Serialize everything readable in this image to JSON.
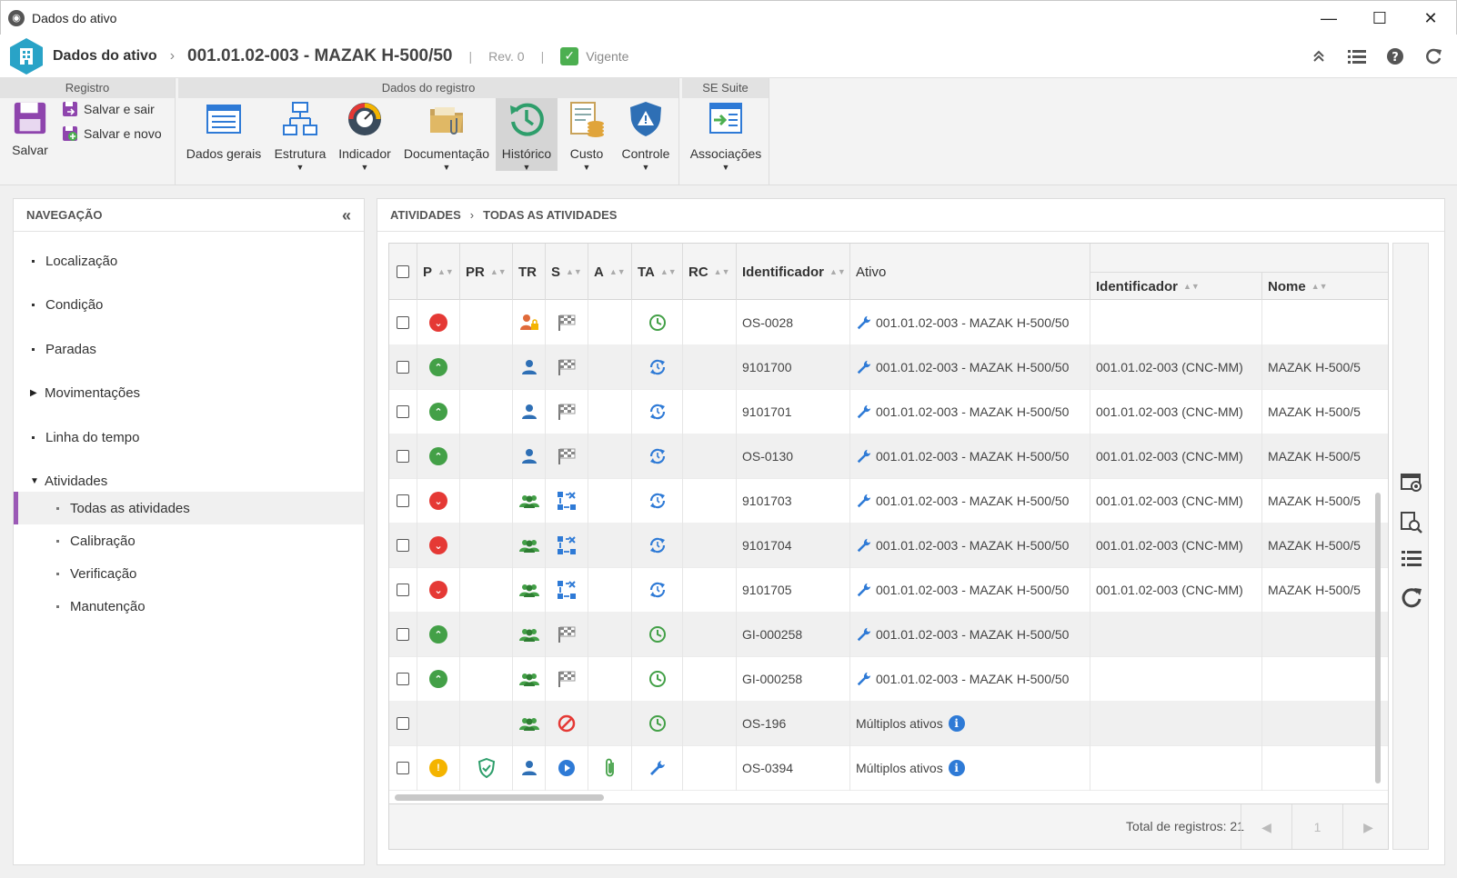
{
  "window": {
    "title": "Dados do ativo"
  },
  "header": {
    "section": "Dados do ativo",
    "asset": "001.01.02-003 - MAZAK H-500/50",
    "revision": "Rev. 0",
    "status": "Vigente",
    "status_color": "#4caf50"
  },
  "ribbon": {
    "groups": {
      "registro": "Registro",
      "dados": "Dados do registro",
      "sesuite": "SE Suite"
    },
    "save": "Salvar",
    "save_exit": "Salvar e sair",
    "save_new": "Salvar e novo",
    "dados_gerais": "Dados gerais",
    "estrutura": "Estrutura",
    "indicador": "Indicador",
    "documentacao": "Documentação",
    "historico": "Histórico",
    "custo": "Custo",
    "controle": "Controle",
    "associacoes": "Associações"
  },
  "nav": {
    "title": "NAVEGAÇÃO",
    "items": [
      "Localização",
      "Condição",
      "Paradas",
      "Movimentações",
      "Linha do tempo",
      "Atividades"
    ],
    "sub": [
      "Todas as atividades",
      "Calibração",
      "Verificação",
      "Manutenção"
    ],
    "accent": "#9b59b6"
  },
  "breadcrumb": {
    "a": "ATIVIDADES",
    "b": "TODAS AS ATIVIDADES"
  },
  "grid": {
    "columns": [
      "P",
      "PR",
      "TR",
      "S",
      "A",
      "TA",
      "RC",
      "Identificador",
      "Ativo",
      "Identificador",
      "Nome"
    ],
    "rows": [
      {
        "p": "down",
        "tr": "user-lock",
        "s": "flag",
        "ta": "clock",
        "id": "OS-0028",
        "ativo": "001.01.02-003 - MAZAK H-500/50",
        "aid": "",
        "nome": ""
      },
      {
        "p": "up",
        "tr": "user",
        "s": "flag",
        "ta": "cycle",
        "id": "9101700",
        "ativo": "001.01.02-003 - MAZAK H-500/50",
        "aid": "001.01.02-003 (CNC-MM)",
        "nome": "MAZAK H-500/5"
      },
      {
        "p": "up",
        "tr": "user",
        "s": "flag",
        "ta": "cycle",
        "id": "9101701",
        "ativo": "001.01.02-003 - MAZAK H-500/50",
        "aid": "001.01.02-003 (CNC-MM)",
        "nome": "MAZAK H-500/5"
      },
      {
        "p": "up",
        "tr": "user",
        "s": "flag",
        "ta": "cycle",
        "id": "OS-0130",
        "ativo": "001.01.02-003 - MAZAK H-500/50",
        "aid": "001.01.02-003 (CNC-MM)",
        "nome": "MAZAK H-500/5"
      },
      {
        "p": "down",
        "tr": "group",
        "s": "workflow",
        "ta": "cycle",
        "id": "9101703",
        "ativo": "001.01.02-003 - MAZAK H-500/50",
        "aid": "001.01.02-003 (CNC-MM)",
        "nome": "MAZAK H-500/5"
      },
      {
        "p": "down",
        "tr": "group",
        "s": "workflow",
        "ta": "cycle",
        "id": "9101704",
        "ativo": "001.01.02-003 - MAZAK H-500/50",
        "aid": "001.01.02-003 (CNC-MM)",
        "nome": "MAZAK H-500/5"
      },
      {
        "p": "down",
        "tr": "group",
        "s": "workflow",
        "ta": "cycle",
        "id": "9101705",
        "ativo": "001.01.02-003 - MAZAK H-500/50",
        "aid": "001.01.02-003 (CNC-MM)",
        "nome": "MAZAK H-500/5"
      },
      {
        "p": "up",
        "tr": "group",
        "s": "flag",
        "ta": "clock",
        "id": "GI-000258",
        "ativo": "001.01.02-003 - MAZAK H-500/50",
        "aid": "",
        "nome": ""
      },
      {
        "p": "up",
        "tr": "group",
        "s": "flag",
        "ta": "clock",
        "id": "GI-000258",
        "ativo": "001.01.02-003 - MAZAK H-500/50",
        "aid": "",
        "nome": ""
      },
      {
        "p": "",
        "tr": "group",
        "s": "blocked",
        "ta": "clock",
        "id": "OS-196",
        "ativo": "Múltiplos ativos",
        "aid": "",
        "nome": ""
      },
      {
        "p": "warn",
        "pr": "shield",
        "tr": "user",
        "s": "play",
        "a": "clip",
        "ta": "wrench",
        "id": "OS-0394",
        "ativo": "Múltiplos ativos",
        "aid": "",
        "nome": ""
      }
    ],
    "total_label": "Total de registros: 21",
    "page": "1"
  }
}
